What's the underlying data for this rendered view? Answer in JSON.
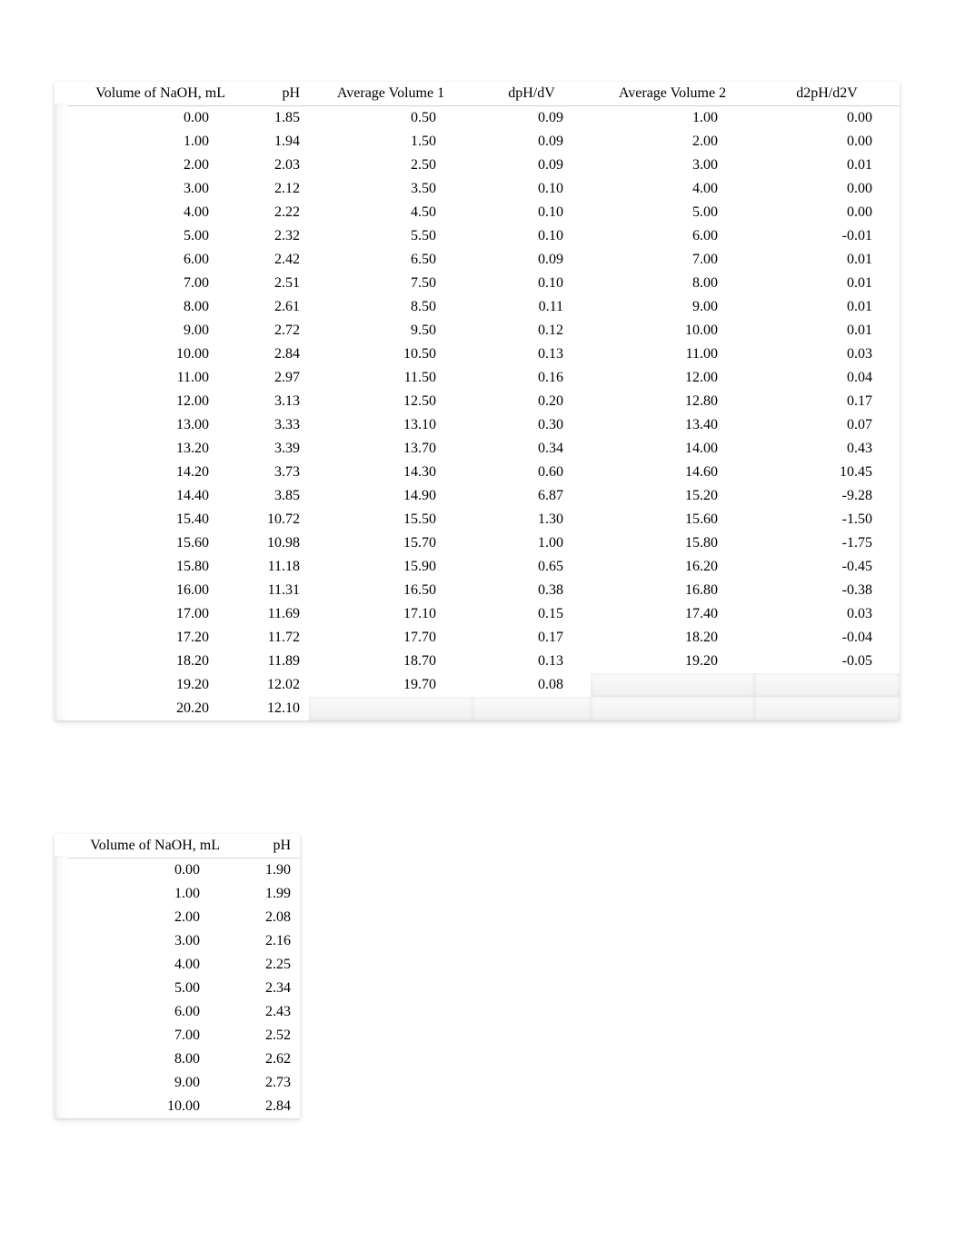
{
  "table1": {
    "headers": [
      "Volume of NaOH, mL",
      "pH",
      "Average Volume 1",
      "dpH/dV",
      "Average Volume 2",
      "d2pH/d2V"
    ],
    "rows": [
      [
        "0.00",
        "1.85",
        "0.50",
        "0.09",
        "1.00",
        "0.00"
      ],
      [
        "1.00",
        "1.94",
        "1.50",
        "0.09",
        "2.00",
        "0.00"
      ],
      [
        "2.00",
        "2.03",
        "2.50",
        "0.09",
        "3.00",
        "0.01"
      ],
      [
        "3.00",
        "2.12",
        "3.50",
        "0.10",
        "4.00",
        "0.00"
      ],
      [
        "4.00",
        "2.22",
        "4.50",
        "0.10",
        "5.00",
        "0.00"
      ],
      [
        "5.00",
        "2.32",
        "5.50",
        "0.10",
        "6.00",
        "-0.01"
      ],
      [
        "6.00",
        "2.42",
        "6.50",
        "0.09",
        "7.00",
        "0.01"
      ],
      [
        "7.00",
        "2.51",
        "7.50",
        "0.10",
        "8.00",
        "0.01"
      ],
      [
        "8.00",
        "2.61",
        "8.50",
        "0.11",
        "9.00",
        "0.01"
      ],
      [
        "9.00",
        "2.72",
        "9.50",
        "0.12",
        "10.00",
        "0.01"
      ],
      [
        "10.00",
        "2.84",
        "10.50",
        "0.13",
        "11.00",
        "0.03"
      ],
      [
        "11.00",
        "2.97",
        "11.50",
        "0.16",
        "12.00",
        "0.04"
      ],
      [
        "12.00",
        "3.13",
        "12.50",
        "0.20",
        "12.80",
        "0.17"
      ],
      [
        "13.00",
        "3.33",
        "13.10",
        "0.30",
        "13.40",
        "0.07"
      ],
      [
        "13.20",
        "3.39",
        "13.70",
        "0.34",
        "14.00",
        "0.43"
      ],
      [
        "14.20",
        "3.73",
        "14.30",
        "0.60",
        "14.60",
        "10.45"
      ],
      [
        "14.40",
        "3.85",
        "14.90",
        "6.87",
        "15.20",
        "-9.28"
      ],
      [
        "15.40",
        "10.72",
        "15.50",
        "1.30",
        "15.60",
        "-1.50"
      ],
      [
        "15.60",
        "10.98",
        "15.70",
        "1.00",
        "15.80",
        "-1.75"
      ],
      [
        "15.80",
        "11.18",
        "15.90",
        "0.65",
        "16.20",
        "-0.45"
      ],
      [
        "16.00",
        "11.31",
        "16.50",
        "0.38",
        "16.80",
        "-0.38"
      ],
      [
        "17.00",
        "11.69",
        "17.10",
        "0.15",
        "17.40",
        "0.03"
      ],
      [
        "17.20",
        "11.72",
        "17.70",
        "0.17",
        "18.20",
        "-0.04"
      ],
      [
        "18.20",
        "11.89",
        "18.70",
        "0.13",
        "19.20",
        "-0.05"
      ],
      [
        "19.20",
        "12.02",
        "19.70",
        "0.08",
        "",
        ""
      ],
      [
        "20.20",
        "12.10",
        "",
        "",
        "",
        ""
      ]
    ]
  },
  "table2": {
    "headers": [
      "Volume of NaOH, mL",
      "pH"
    ],
    "rows": [
      [
        "0.00",
        "1.90"
      ],
      [
        "1.00",
        "1.99"
      ],
      [
        "2.00",
        "2.08"
      ],
      [
        "3.00",
        "2.16"
      ],
      [
        "4.00",
        "2.25"
      ],
      [
        "5.00",
        "2.34"
      ],
      [
        "6.00",
        "2.43"
      ],
      [
        "7.00",
        "2.52"
      ],
      [
        "8.00",
        "2.62"
      ],
      [
        "9.00",
        "2.73"
      ],
      [
        "10.00",
        "2.84"
      ]
    ]
  }
}
